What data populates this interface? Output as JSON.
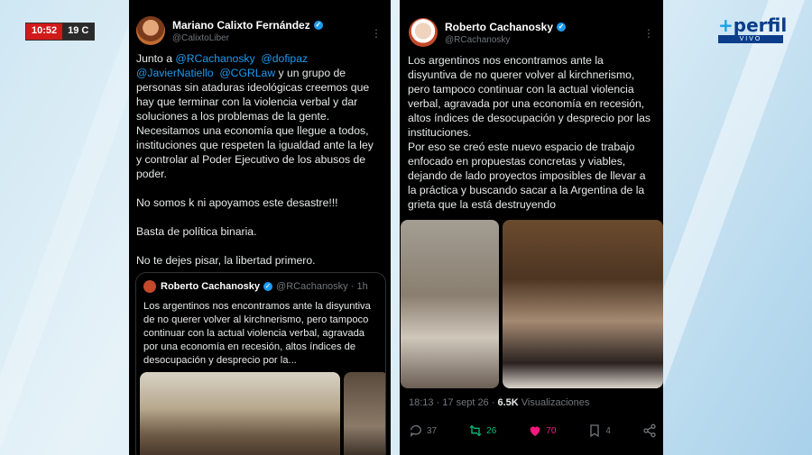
{
  "overlay": {
    "clock_time": "10:52",
    "temperature": "19 C",
    "channel_brand": "perfil",
    "channel_live": "VIVO"
  },
  "tweet_left": {
    "author_name": "Mariano Calixto Fernández",
    "author_handle": "@CalixtoLiber",
    "text_lines": [
      {
        "pre": "Junto a ",
        "m1": "@RCachanosky",
        "mid": "  ",
        "m2": "@dofipaz"
      },
      {
        "m1": "@JavierNatiello",
        "mid": "  ",
        "m2": "@CGRLaw",
        "post": " y un grupo de"
      }
    ],
    "paragraph1": "personas sin ataduras ideológicas creemos que hay que terminar con la violencia verbal y dar soluciones a los problemas de la gente. Necesitamos una economía que llegue a todos, instituciones que respeten la igualdad ante la ley y controlar al Poder Ejecutivo de los abusos de poder.",
    "paragraph2": "No somos k ni apoyamos este desastre!!!",
    "paragraph3": "Basta de política binaria.",
    "paragraph4": "No te dejes pisar, la libertad primero.",
    "quote": {
      "author_name": "Roberto Cachanosky",
      "author_handle": "@RCachanosky · 1h",
      "text": "Los argentinos nos encontramos ante la disyuntiva de no querer volver al kirchnerismo, pero tampoco continuar con la actual violencia verbal, agravada por una economía en recesión, altos índices de desocupación y desprecio por la..."
    }
  },
  "tweet_right": {
    "author_name": "Roberto Cachanosky",
    "author_handle": "@RCachanosky",
    "paragraph1": "Los argentinos nos encontramos ante la disyuntiva de no querer volver al kirchnerismo, pero tampoco continuar con la actual violencia verbal, agravada por una economía en recesión, altos índices de desocupación y desprecio por las instituciones.",
    "paragraph2": "Por eso se creó este nuevo espacio de trabajo enfocado en propuestas concretas y viables, dejando de lado proyectos imposibles de llevar a la práctica y buscando sacar a la Argentina de la grieta que la está destruyendo",
    "meta_time": "18:13 · 17 sept 26 · ",
    "meta_views_count": "6.5K",
    "meta_views_label": " Visualizaciones",
    "actions": {
      "replies": "37",
      "retweets": "26",
      "likes": "70",
      "bookmarks": "4"
    }
  },
  "colors": {
    "background": "#000000",
    "link": "#1d9bf0",
    "muted": "#71767b",
    "retweet": "#00ba7c",
    "like": "#f91880",
    "clock_red": "#d11a1a",
    "brand_blue": "#0b3d8a"
  }
}
